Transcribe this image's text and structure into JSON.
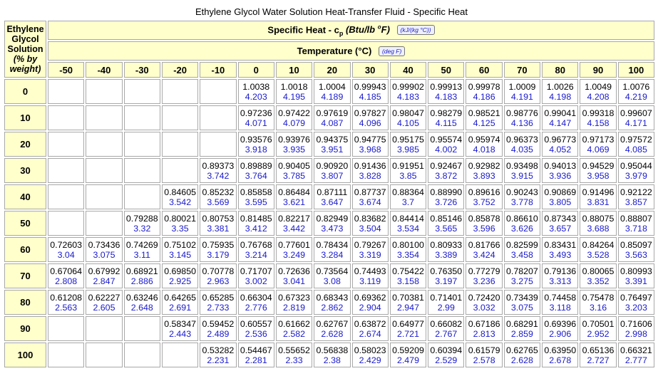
{
  "title": "Ethylene Glycol Water Solution Heat-Transfer Fluid - Specific Heat",
  "corner_lines": [
    "Ethylene",
    "Glycol",
    "Solution",
    "(% by",
    "weight)"
  ],
  "specific_heat_header": {
    "prefix": "Specific Heat - c",
    "sub": "p",
    "unit_open": " (Btu/lb ",
    "sup": "o",
    "unit_close": "F)",
    "button": "(kJ/(kg °C))"
  },
  "temperature_header": {
    "label": "Temperature (°C)",
    "button": "(deg F)"
  },
  "temperatures": [
    "-50",
    "-40",
    "-30",
    "-20",
    "-10",
    "0",
    "10",
    "20",
    "30",
    "40",
    "50",
    "60",
    "70",
    "80",
    "90",
    "100"
  ],
  "rows": [
    {
      "conc": "0",
      "cells": [
        null,
        null,
        null,
        null,
        null,
        [
          "1.0038",
          "4.203"
        ],
        [
          "1.0018",
          "4.195"
        ],
        [
          "1.0004",
          "4.189"
        ],
        [
          "0.99943",
          "4.185"
        ],
        [
          "0.99902",
          "4.183"
        ],
        [
          "0.99913",
          "4.183"
        ],
        [
          "0.99978",
          "4.186"
        ],
        [
          "1.0009",
          "4.191"
        ],
        [
          "1.0026",
          "4.198"
        ],
        [
          "1.0049",
          "4.208"
        ],
        [
          "1.0076",
          "4.219"
        ]
      ]
    },
    {
      "conc": "10",
      "cells": [
        null,
        null,
        null,
        null,
        null,
        [
          "0.97236",
          "4.071"
        ],
        [
          "0.97422",
          "4.079"
        ],
        [
          "0.97619",
          "4.087"
        ],
        [
          "0.97827",
          "4.096"
        ],
        [
          "0.98047",
          "4.105"
        ],
        [
          "0.98279",
          "4.115"
        ],
        [
          "0.98521",
          "4.125"
        ],
        [
          "0.98776",
          "4.136"
        ],
        [
          "0.99041",
          "4.147"
        ],
        [
          "0.99318",
          "4.158"
        ],
        [
          "0.99607",
          "4.171"
        ]
      ]
    },
    {
      "conc": "20",
      "cells": [
        null,
        null,
        null,
        null,
        null,
        [
          "0.93576",
          "3.918"
        ],
        [
          "0.93976",
          "3.935"
        ],
        [
          "0.94375",
          "3.951"
        ],
        [
          "0.94775",
          "3.968"
        ],
        [
          "0.95175",
          "3.985"
        ],
        [
          "0.95574",
          "4.002"
        ],
        [
          "0.95974",
          "4.018"
        ],
        [
          "0.96373",
          "4.035"
        ],
        [
          "0.96773",
          "4.052"
        ],
        [
          "0.97173",
          "4.069"
        ],
        [
          "0.97572",
          "4.085"
        ]
      ]
    },
    {
      "conc": "30",
      "cells": [
        null,
        null,
        null,
        null,
        [
          "0.89373",
          "3.742"
        ],
        [
          "0.89889",
          "3.764"
        ],
        [
          "0.90405",
          "3.785"
        ],
        [
          "0.90920",
          "3.807"
        ],
        [
          "0.91436",
          "3.828"
        ],
        [
          "0.91951",
          "3.85"
        ],
        [
          "0.92467",
          "3.872"
        ],
        [
          "0.92982",
          "3.893"
        ],
        [
          "0.93498",
          "3.915"
        ],
        [
          "0.94013",
          "3.936"
        ],
        [
          "0.94529",
          "3.958"
        ],
        [
          "0.95044",
          "3.979"
        ]
      ]
    },
    {
      "conc": "40",
      "cells": [
        null,
        null,
        null,
        [
          "0.84605",
          "3.542"
        ],
        [
          "0.85232",
          "3.569"
        ],
        [
          "0.85858",
          "3.595"
        ],
        [
          "0.86484",
          "3.621"
        ],
        [
          "0.87111",
          "3.647"
        ],
        [
          "0.87737",
          "3.674"
        ],
        [
          "0.88364",
          "3.7"
        ],
        [
          "0.88990",
          "3.726"
        ],
        [
          "0.89616",
          "3.752"
        ],
        [
          "0.90243",
          "3.778"
        ],
        [
          "0.90869",
          "3.805"
        ],
        [
          "0.91496",
          "3.831"
        ],
        [
          "0.92122",
          "3.857"
        ]
      ]
    },
    {
      "conc": "50",
      "cells": [
        null,
        null,
        [
          "0.79288",
          "3.32"
        ],
        [
          "0.80021",
          "3.35"
        ],
        [
          "0.80753",
          "3.381"
        ],
        [
          "0.81485",
          "3.412"
        ],
        [
          "0.82217",
          "3.442"
        ],
        [
          "0.82949",
          "3.473"
        ],
        [
          "0.83682",
          "3.504"
        ],
        [
          "0.84414",
          "3.534"
        ],
        [
          "0.85146",
          "3.565"
        ],
        [
          "0.85878",
          "3.596"
        ],
        [
          "0.86610",
          "3.626"
        ],
        [
          "0.87343",
          "3.657"
        ],
        [
          "0.88075",
          "3.688"
        ],
        [
          "0.88807",
          "3.718"
        ]
      ]
    },
    {
      "conc": "60",
      "cells": [
        [
          "0.72603",
          "3.04"
        ],
        [
          "0.73436",
          "3.075"
        ],
        [
          "0.74269",
          "3.11"
        ],
        [
          "0.75102",
          "3.145"
        ],
        [
          "0.75935",
          "3.179"
        ],
        [
          "0.76768",
          "3.214"
        ],
        [
          "0.77601",
          "3.249"
        ],
        [
          "0.78434",
          "3.284"
        ],
        [
          "0.79267",
          "3.319"
        ],
        [
          "0.80100",
          "3.354"
        ],
        [
          "0.80933",
          "3.389"
        ],
        [
          "0.81766",
          "3.424"
        ],
        [
          "0.82599",
          "3.458"
        ],
        [
          "0.83431",
          "3.493"
        ],
        [
          "0.84264",
          "3.528"
        ],
        [
          "0.85097",
          "3.563"
        ]
      ]
    },
    {
      "conc": "70",
      "cells": [
        [
          "0.67064",
          "2.808"
        ],
        [
          "0.67992",
          "2.847"
        ],
        [
          "0.68921",
          "2.886"
        ],
        [
          "0.69850",
          "2.925"
        ],
        [
          "0.70778",
          "2.963"
        ],
        [
          "0.71707",
          "3.002"
        ],
        [
          "0.72636",
          "3.041"
        ],
        [
          "0.73564",
          "3.08"
        ],
        [
          "0.74493",
          "3.119"
        ],
        [
          "0.75422",
          "3.158"
        ],
        [
          "0.76350",
          "3.197"
        ],
        [
          "0.77279",
          "3.236"
        ],
        [
          "0.78207",
          "3.275"
        ],
        [
          "0.79136",
          "3.313"
        ],
        [
          "0.80065",
          "3.352"
        ],
        [
          "0.80993",
          "3.391"
        ]
      ]
    },
    {
      "conc": "80",
      "cells": [
        [
          "0.61208",
          "2.563"
        ],
        [
          "0.62227",
          "2.605"
        ],
        [
          "0.63246",
          "2.648"
        ],
        [
          "0.64265",
          "2.691"
        ],
        [
          "0.65285",
          "2.733"
        ],
        [
          "0.66304",
          "2.776"
        ],
        [
          "0.67323",
          "2.819"
        ],
        [
          "0.68343",
          "2.862"
        ],
        [
          "0.69362",
          "2.904"
        ],
        [
          "0.70381",
          "2.947"
        ],
        [
          "0.71401",
          "2.99"
        ],
        [
          "0.72420",
          "3.032"
        ],
        [
          "0.73439",
          "3.075"
        ],
        [
          "0.74458",
          "3.118"
        ],
        [
          "0.75478",
          "3.16"
        ],
        [
          "0.76497",
          "3.203"
        ]
      ]
    },
    {
      "conc": "90",
      "cells": [
        null,
        null,
        null,
        [
          "0.58347",
          "2.443"
        ],
        [
          "0.59452",
          "2.489"
        ],
        [
          "0.60557",
          "2.536"
        ],
        [
          "0.61662",
          "2.582"
        ],
        [
          "0.62767",
          "2.628"
        ],
        [
          "0.63872",
          "2.674"
        ],
        [
          "0.64977",
          "2.721"
        ],
        [
          "0.66082",
          "2.767"
        ],
        [
          "0.67186",
          "2.813"
        ],
        [
          "0.68291",
          "2.859"
        ],
        [
          "0.69396",
          "2.906"
        ],
        [
          "0.70501",
          "2.952"
        ],
        [
          "0.71606",
          "2.998"
        ]
      ]
    },
    {
      "conc": "100",
      "cells": [
        null,
        null,
        null,
        null,
        [
          "0.53282",
          "2.231"
        ],
        [
          "0.54467",
          "2.281"
        ],
        [
          "0.55652",
          "2.33"
        ],
        [
          "0.56838",
          "2.38"
        ],
        [
          "0.58023",
          "2.429"
        ],
        [
          "0.59209",
          "2.479"
        ],
        [
          "0.60394",
          "2.529"
        ],
        [
          "0.61579",
          "2.578"
        ],
        [
          "0.62765",
          "2.628"
        ],
        [
          "0.63950",
          "2.678"
        ],
        [
          "0.65136",
          "2.727"
        ],
        [
          "0.66321",
          "2.777"
        ]
      ]
    }
  ],
  "colors": {
    "header_bg": "#ffffcc",
    "border": "#a8a8a8",
    "si_value": "#1a1acc",
    "imperial_value": "#000000"
  }
}
